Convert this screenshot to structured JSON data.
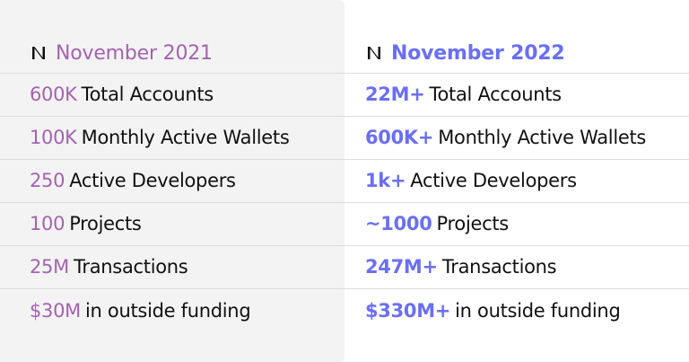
{
  "left": {
    "header": "November 2021",
    "rows": [
      {
        "num": "600K",
        "text": "Total Accounts"
      },
      {
        "num": "100K",
        "text": "Monthly Active Wallets"
      },
      {
        "num": "250",
        "text": "Active Developers"
      },
      {
        "num": "100",
        "text": "Projects"
      },
      {
        "num": "25M",
        "text": "Transactions"
      },
      {
        "num": "$30M",
        "text": "in outside funding"
      }
    ]
  },
  "right": {
    "header": "November 2022",
    "rows": [
      {
        "num": "22M+",
        "text": "Total Accounts"
      },
      {
        "num": "600K+",
        "text": "Monthly Active Wallets"
      },
      {
        "num": "1k+",
        "text": "Active Developers"
      },
      {
        "num": "~1000",
        "text": "Projects"
      },
      {
        "num": "247M+",
        "text": "Transactions"
      },
      {
        "num": "$330M+",
        "text": "in outside funding"
      }
    ]
  },
  "colors": {
    "left_accent": "#a463b0",
    "right_accent": "#6a6ff2",
    "left_bg": "#f3f3f3"
  },
  "icons": {
    "header": "near-logo-icon"
  }
}
